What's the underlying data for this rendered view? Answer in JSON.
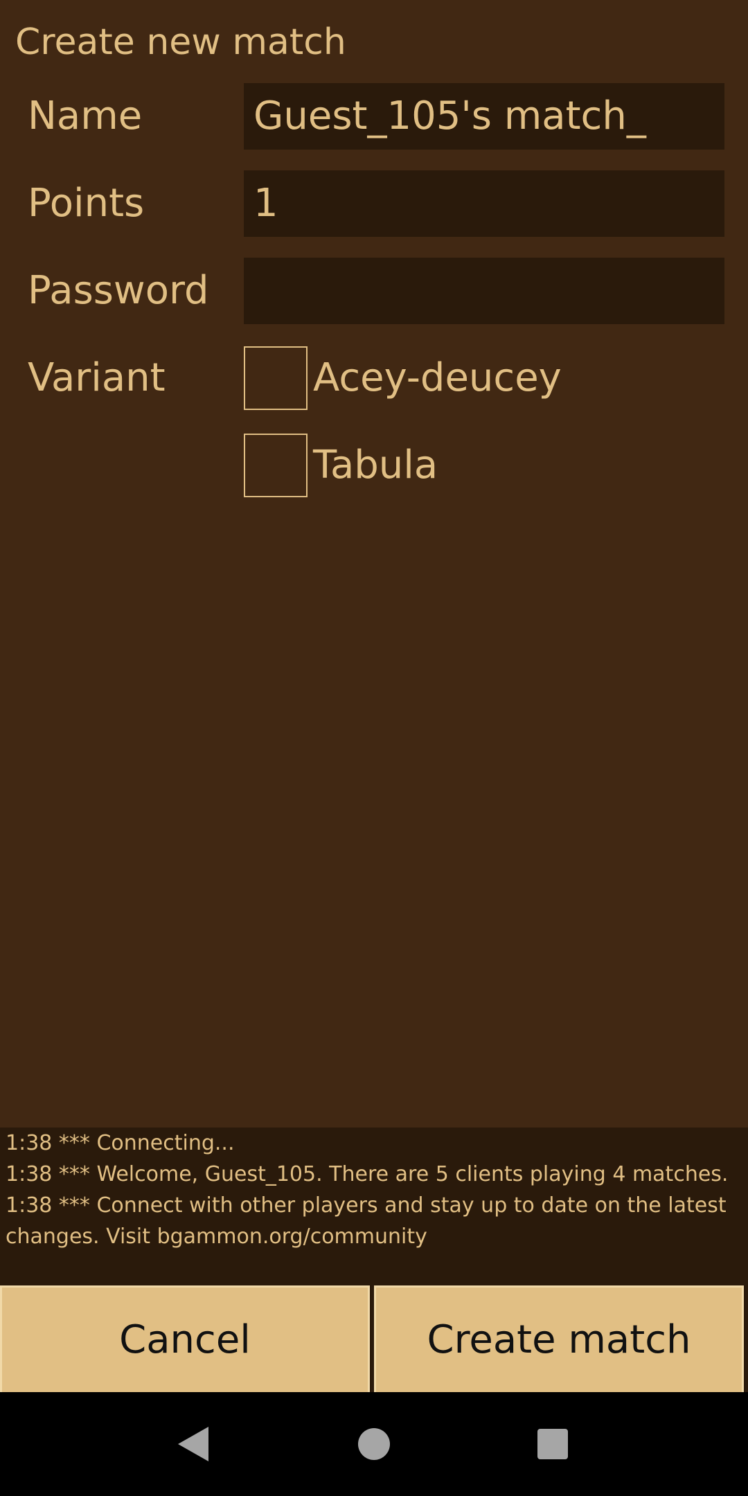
{
  "dialog": {
    "title": "Create new match",
    "fields": {
      "name": {
        "label": "Name",
        "value": "Guest_105's match_"
      },
      "points": {
        "label": "Points",
        "value": "1"
      },
      "password": {
        "label": "Password",
        "value": ""
      }
    },
    "variant": {
      "label": "Variant",
      "options": [
        {
          "label": "Acey-deucey",
          "checked": false
        },
        {
          "label": "Tabula",
          "checked": false
        }
      ]
    }
  },
  "log": {
    "lines": [
      "1:38 *** Connecting...",
      "1:38 *** Welcome, Guest_105. There are 5 clients playing 4 matches.",
      "1:38 *** Connect with other players and stay up to date on the latest",
      "changes. Visit bgammon.org/community"
    ]
  },
  "buttons": {
    "cancel_label": "Cancel",
    "create_label": "Create match"
  },
  "navigation": {
    "back_icon": "back-triangle-icon",
    "home_icon": "home-circle-icon",
    "recents_icon": "recents-square-icon"
  },
  "colors": {
    "background": "#412813",
    "input_background": "#2a1a0b",
    "accent_text": "#e1bf84",
    "button_background": "#e1bf84",
    "nav_background": "#000000"
  }
}
